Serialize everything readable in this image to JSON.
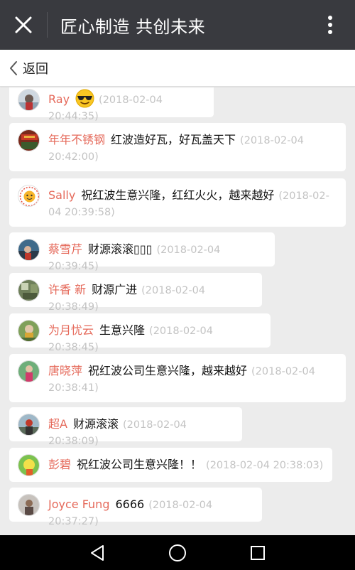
{
  "header": {
    "title": "匠心制造 共创未来"
  },
  "backbar": {
    "back_label": "返回"
  },
  "messages": [
    {
      "name": "Ray",
      "text": "",
      "time": "(2018-02-04 20:44:35)",
      "emoji": "sunglasses-emoji"
    },
    {
      "name": "年年不锈钢",
      "text": "红波造好瓦，好瓦盖天下",
      "time": "(2018-02-04 20:42:00)"
    },
    {
      "name": "Sally",
      "text": "祝红波生意兴隆，红红火火，越来越好",
      "time": "(2018-02-04 20:39:58)"
    },
    {
      "name": "蔡雪芹",
      "text": "财源滚滚▯▯▯",
      "time": "(2018-02-04 20:39:45)"
    },
    {
      "name": "许香 新",
      "text": "财源广进",
      "time": "(2018-02-04 20:38:49)"
    },
    {
      "name": "为月忧云",
      "text": "生意兴隆",
      "time": "(2018-02-04 20:38:45)"
    },
    {
      "name": "唐晓萍",
      "text": "祝红波公司生意兴隆，越来越好",
      "time": "(2018-02-04 20:38:41)"
    },
    {
      "name": "超A",
      "text": "财源滚滚",
      "time": "(2018-02-04 20:38:09)"
    },
    {
      "name": "彭碧",
      "text": "祝红波公司生意兴隆！！",
      "time": "(2018-02-04 20:38:03)"
    },
    {
      "name": "Joyce Fung",
      "text": "6666",
      "time": "(2018-02-04 20:37:27)"
    }
  ],
  "colors": {
    "appbar": "#393a3f",
    "name": "#e5695a",
    "time": "#c3c3c3",
    "background": "#ececec"
  },
  "icons": {
    "close": "close-icon",
    "more": "more-vertical-icon",
    "back": "chevron-left-icon",
    "nav_back": "triangle-back-icon",
    "nav_home": "circle-home-icon",
    "nav_recent": "square-recent-icon"
  }
}
